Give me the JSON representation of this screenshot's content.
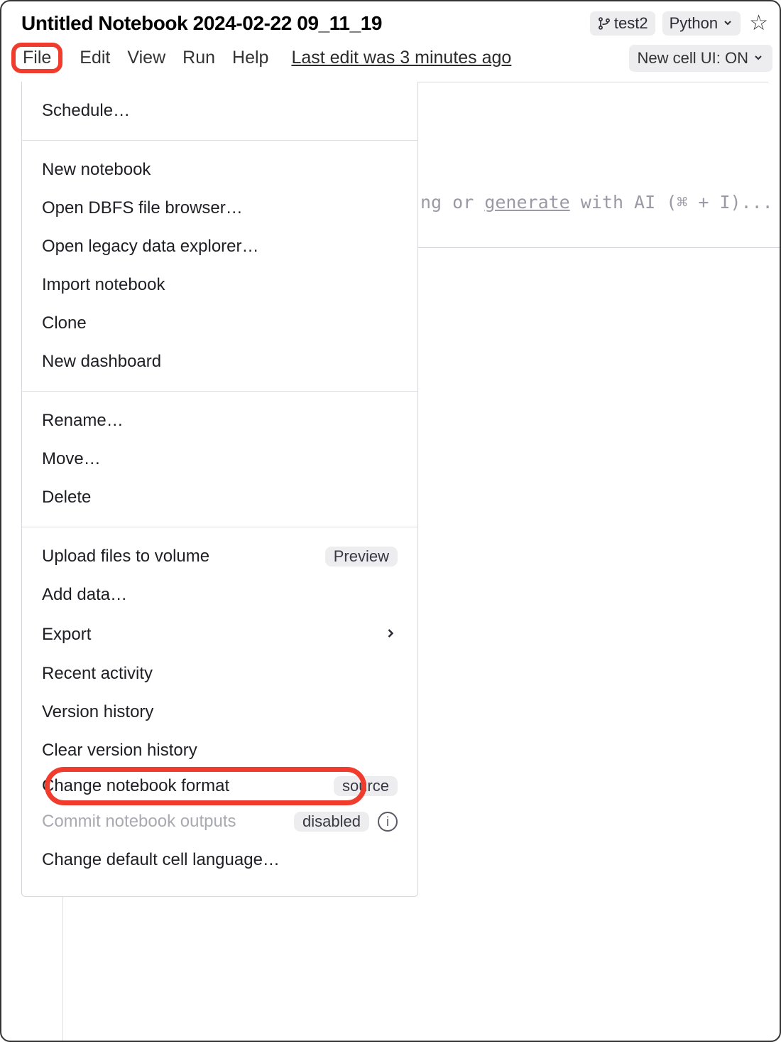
{
  "header": {
    "title": "Untitled Notebook 2024-02-22 09_11_19",
    "branch_name": "test2",
    "language": "Python",
    "star_favorited": false
  },
  "menubar": {
    "items": [
      "File",
      "Edit",
      "View",
      "Run",
      "Help"
    ],
    "active": "File",
    "last_edit_text": "Last edit was 3 minutes ago",
    "new_cell_ui_label": "New cell UI: ON"
  },
  "file_menu": {
    "sections": [
      [
        {
          "label": "Schedule…"
        }
      ],
      [
        {
          "label": "New notebook"
        },
        {
          "label": "Open DBFS file browser…"
        },
        {
          "label": "Open legacy data explorer…"
        },
        {
          "label": "Import notebook"
        },
        {
          "label": "Clone"
        },
        {
          "label": "New dashboard"
        }
      ],
      [
        {
          "label": "Rename…"
        },
        {
          "label": "Move…"
        },
        {
          "label": "Delete"
        }
      ],
      [
        {
          "label": "Upload files to volume",
          "badge": "Preview"
        },
        {
          "label": "Add data…"
        },
        {
          "label": "Export",
          "submenu": true
        },
        {
          "label": "Recent activity"
        },
        {
          "label": "Version history"
        },
        {
          "label": "Clear version history"
        },
        {
          "label": "Change notebook format",
          "badge": "source",
          "highlight": true
        },
        {
          "label": "Commit notebook outputs",
          "badge": "disabled",
          "info": true,
          "disabled": true
        },
        {
          "label": "Change default cell language…"
        }
      ]
    ]
  },
  "code_cell": {
    "placeholder_part1": "ng or ",
    "placeholder_generate": "generate",
    "placeholder_part2": " with AI (⌘ + I)..."
  }
}
